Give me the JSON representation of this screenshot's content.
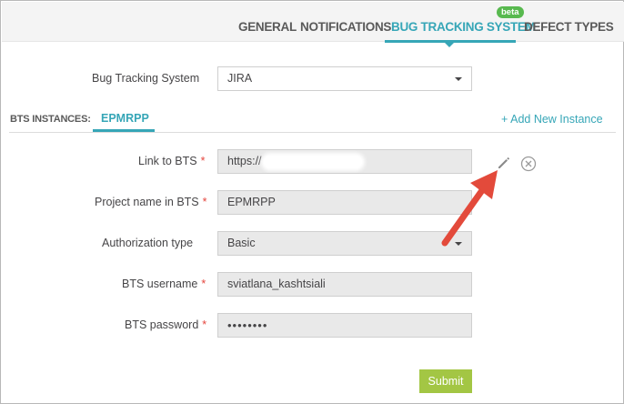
{
  "tabs": [
    {
      "label": "GENERAL"
    },
    {
      "label": "NOTIFICATIONS"
    },
    {
      "label": "BUG TRACKING SYSTEM",
      "badge": "beta"
    },
    {
      "label": "DEFECT TYPES"
    }
  ],
  "bts_select": {
    "label": "Bug Tracking System",
    "value": "JIRA"
  },
  "instances": {
    "label": "BTS INSTANCES:",
    "active": "EPMRPP",
    "add_new": "Add New Instance"
  },
  "form": {
    "link": {
      "label": "Link to BTS",
      "value": "https://"
    },
    "project": {
      "label": "Project name in BTS",
      "value": "EPMRPP"
    },
    "auth": {
      "label": "Authorization type",
      "value": "Basic"
    },
    "username": {
      "label": "BTS username",
      "value": "sviatlana_kashtsiali"
    },
    "password": {
      "label": "BTS password",
      "value": "••••••••"
    },
    "required_mark": "*"
  },
  "submit_label": "Submit",
  "icons": {
    "edit": "pencil-icon",
    "remove": "close-circle-icon",
    "add": "plus-icon"
  },
  "colors": {
    "accent": "#36a6b7",
    "submit": "#a3c644",
    "required": "#e5453d",
    "arrow": "#e34a3b",
    "beta": "#58b94f"
  }
}
